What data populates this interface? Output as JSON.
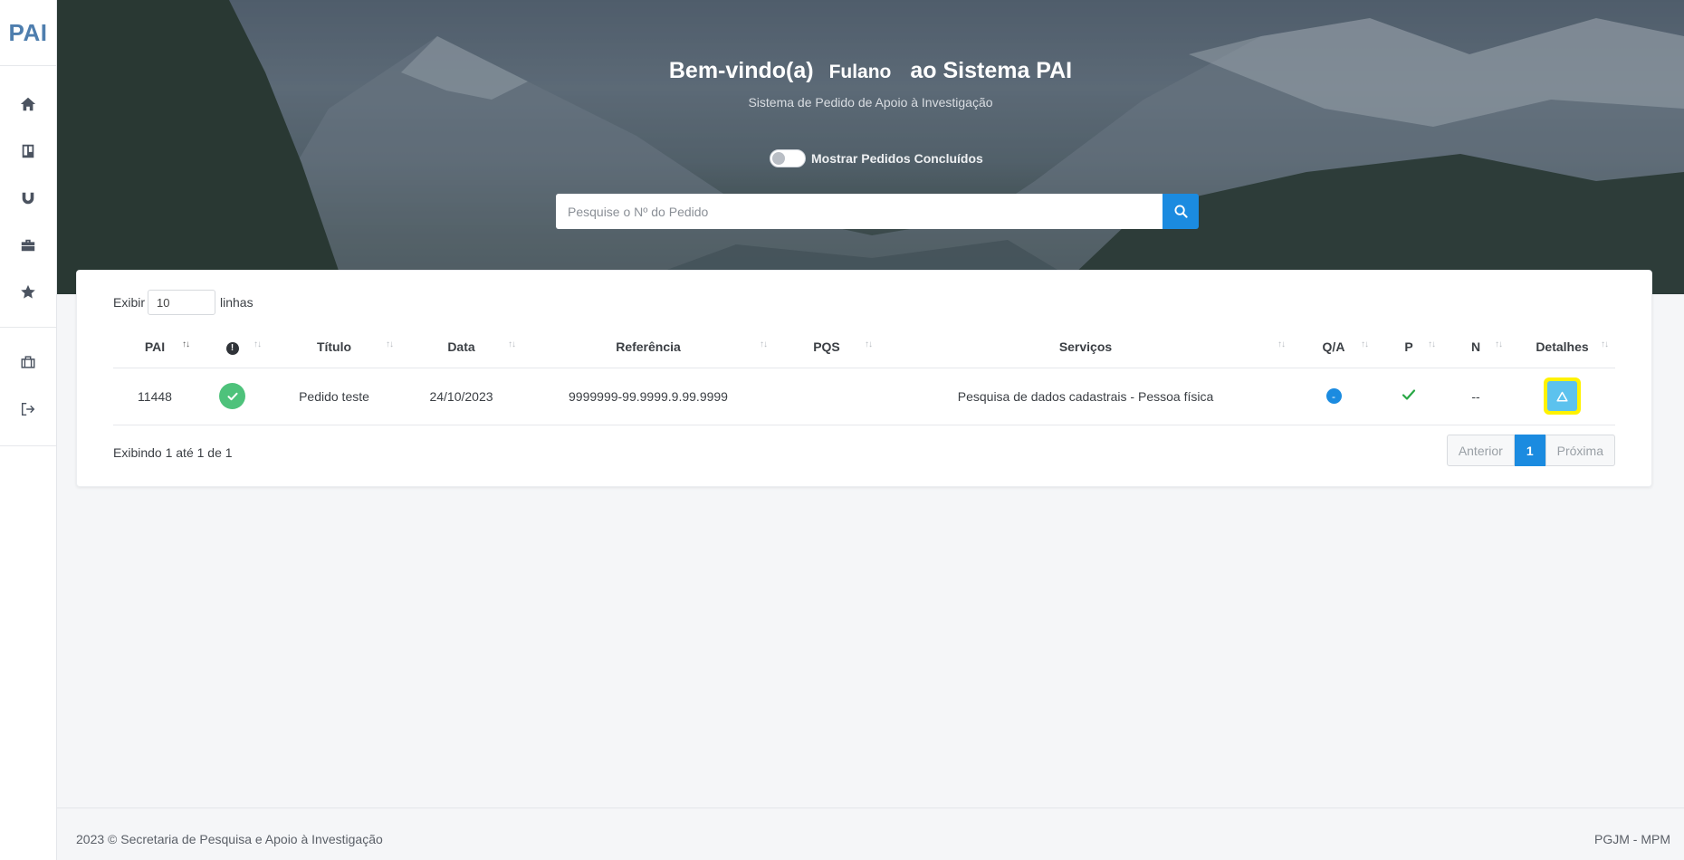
{
  "brand": "PAI",
  "sidebar": {
    "items": [
      {
        "icon": "home-icon"
      },
      {
        "icon": "board-icon"
      },
      {
        "icon": "magnet-icon"
      },
      {
        "icon": "briefcase-icon"
      },
      {
        "icon": "star-icon"
      },
      {
        "icon": "suitcase-icon"
      },
      {
        "icon": "logout-icon"
      }
    ]
  },
  "hero": {
    "greeting": "Bem-vindo(a)",
    "user": "Fulano",
    "suffix": "ao Sistema PAI",
    "subtitle": "Sistema de Pedido de Apoio à Investigação",
    "toggle_label": "Mostrar Pedidos Concluídos",
    "toggle_on": false,
    "search_placeholder": "Pesquise o Nº do Pedido"
  },
  "table": {
    "show_label": "Exibir",
    "show_value": "10",
    "rows_label": "linhas",
    "columns": [
      "PAI",
      "",
      "Título",
      "Data",
      "Referência",
      "PQS",
      "Serviços",
      "Q/A",
      "P",
      "N",
      "Detalhes"
    ],
    "rows": [
      {
        "pai": "11448",
        "status": "check",
        "titulo": "Pedido teste",
        "data": "24/10/2023",
        "referencia": "9999999-99.9999.9.99.9999",
        "pqs": "",
        "servicos": "Pesquisa de dados cadastrais - Pessoa física",
        "qa": "-",
        "p": "check",
        "n": "--"
      }
    ],
    "info": "Exibindo 1 até 1 de 1",
    "pager": {
      "prev": "Anterior",
      "current": "1",
      "next": "Próxima"
    }
  },
  "footer": {
    "left": "2023 © Secretaria de Pesquisa e Apoio à Investigação",
    "right": "PGJM - MPM"
  },
  "colors": {
    "accent": "#1b8be0",
    "success": "#4ec27b",
    "details_button": "#5cc2ee",
    "highlight": "#fff200",
    "brand": "#4e7eae"
  }
}
